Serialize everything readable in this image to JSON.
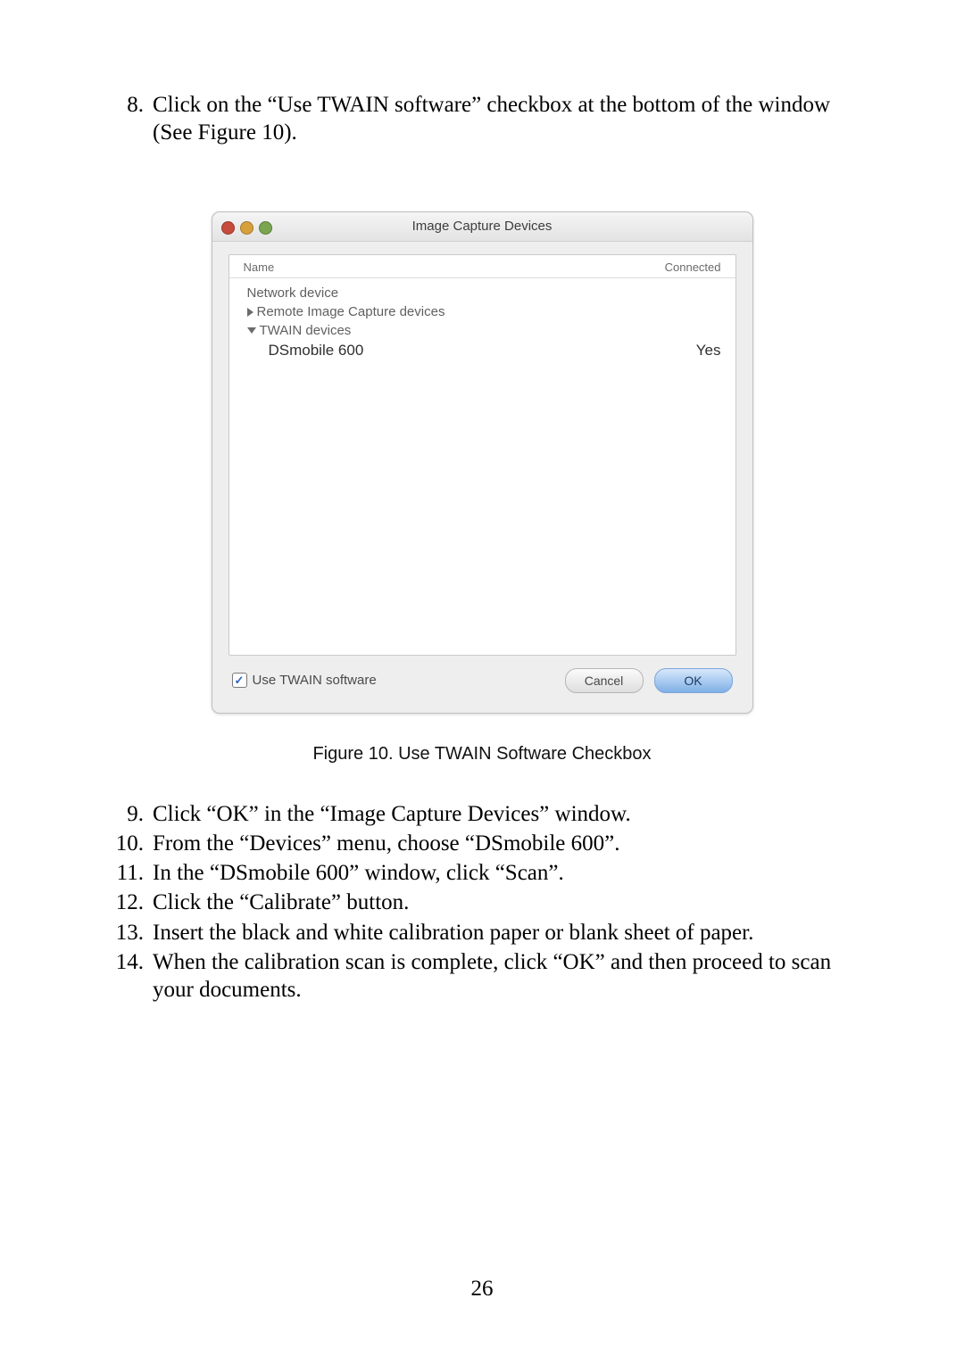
{
  "step8": {
    "num": "8.",
    "text": "Click on the “Use TWAIN software” checkbox at the bottom of the window (See Figure 10)."
  },
  "window": {
    "title": "Image Capture Devices",
    "col1": "Name",
    "col2": "Connected",
    "row_network": "Network device",
    "row_remote": "Remote Image Capture devices",
    "row_twain": "TWAIN devices",
    "row_device": "DSmobile 600",
    "row_device_status": "Yes",
    "checkbox_label": "Use TWAIN software",
    "btn_cancel": "Cancel",
    "btn_ok": "OK"
  },
  "caption": "Figure 10. Use TWAIN Software Checkbox",
  "steps": {
    "s9": {
      "num": "9.",
      "text": "Click “OK” in the “Image Capture Devices” window."
    },
    "s10": {
      "num": "10.",
      "text": "From the “Devices” menu, choose “DSmobile 600”."
    },
    "s11": {
      "num": "11.",
      "text": "In the “DSmobile 600” window, click “Scan”."
    },
    "s12": {
      "num": "12.",
      "text": "Click the “Calibrate” button."
    },
    "s13": {
      "num": "13.",
      "text": "Insert the black and white calibration paper or blank sheet of paper."
    },
    "s14": {
      "num": "14.",
      "text": "When the calibration scan is complete, click “OK” and then proceed to scan your documents."
    }
  },
  "page_number": "26"
}
